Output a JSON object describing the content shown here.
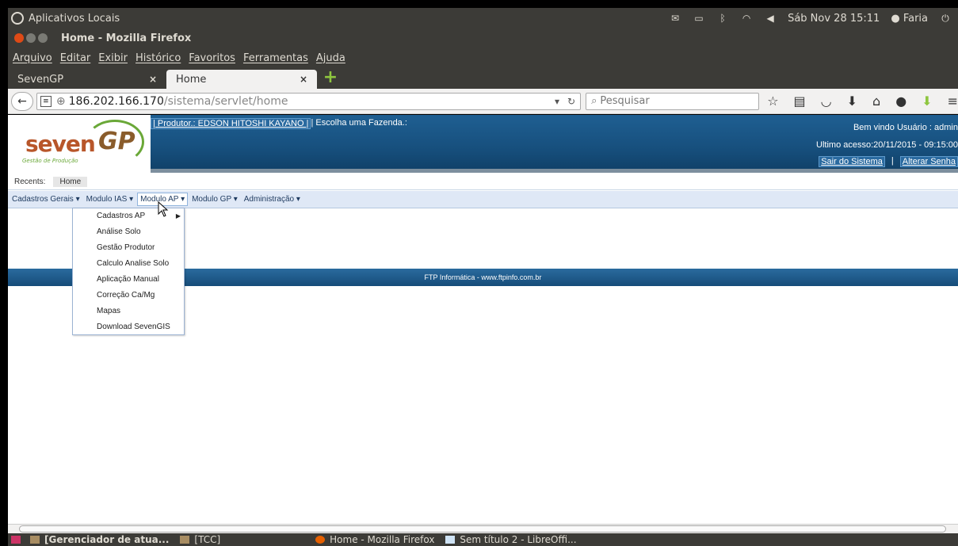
{
  "top_panel": {
    "app_menu": "Aplicativos Locais",
    "datetime": "Sáb Nov 28 15:11",
    "user": "Faria"
  },
  "window": {
    "title": "Home - Mozilla Firefox"
  },
  "menubar": {
    "items": [
      "Arquivo",
      "Editar",
      "Exibir",
      "Histórico",
      "Favoritos",
      "Ferramentas",
      "Ajuda"
    ]
  },
  "tabs": [
    {
      "label": "SevenGP",
      "close": "×"
    },
    {
      "label": "Home",
      "close": "×"
    }
  ],
  "navbar": {
    "url_host": "186.202.166.170",
    "url_path": "/sistema/servlet/home",
    "search_placeholder": "Pesquisar"
  },
  "site": {
    "logo_word": "seven",
    "logo_gp": "GP",
    "logo_tagline": "Gestão de Produção",
    "producer_link": "| Produtor.: EDSON HITOSHI KAYANO |",
    "farm_prompt": "| Escolha uma Fazenda.:",
    "welcome": "Bem vindo Usuário : admin",
    "last_access": "Ultimo acesso:20/11/2015 - 09:15:00",
    "logout": "Sair do Sistema",
    "separator": "|",
    "change_password": "Alterar Senha",
    "recents_label": "Recents:",
    "recents_home": "Home",
    "main_menu": [
      {
        "label": "Cadastros Gerais ▾"
      },
      {
        "label": "Modulo IAS ▾"
      },
      {
        "label": "Modulo AP ▾"
      },
      {
        "label": "Modulo GP ▾"
      },
      {
        "label": "Administração ▾"
      }
    ],
    "dropdown": [
      "Cadastros AP",
      "Análise Solo",
      "Gestão Produtor",
      "Calculo Analise Solo",
      "Aplicação Manual",
      "Correção Ca/Mg",
      "Mapas",
      "Download SevenGIS"
    ],
    "footer": "FTP Informática - www.ftpinfo.com.br"
  },
  "taskbar": [
    {
      "label": "[Gerenciador de atua..."
    },
    {
      "label": "[TCC]"
    },
    {
      "label": "Home - Mozilla Firefox"
    },
    {
      "label": "Sem título 2 - LibreOffi..."
    }
  ]
}
